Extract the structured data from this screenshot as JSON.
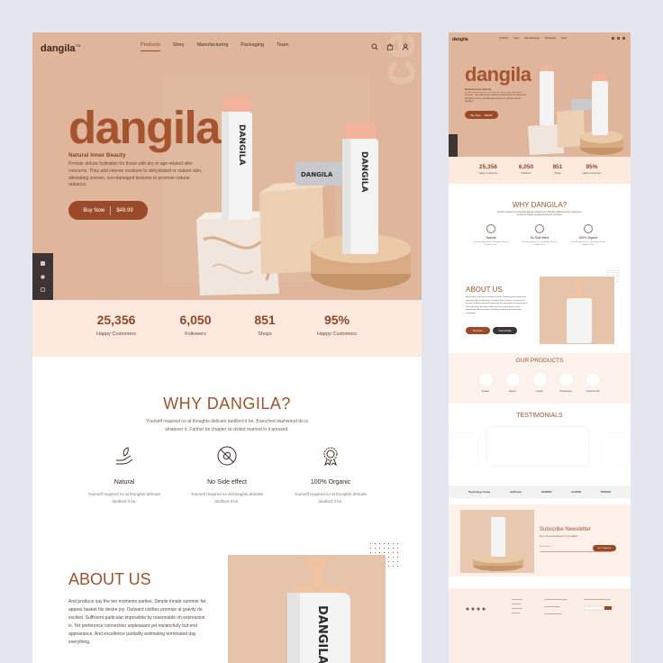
{
  "main": {
    "logo": "dangila",
    "logo_tm": "TM",
    "nav": [
      "Products",
      "Story",
      "Manufacturing",
      "Packaging",
      "Team"
    ],
    "nav_active": "Products",
    "nav_icons": [
      "search-icon",
      "bag-icon",
      "user-icon"
    ],
    "hero": {
      "title": "dangila",
      "tagline": "Natural Inner Beauty",
      "description": "Provide deluxe hydration for those with dry or age-related skin concerns. They add intense moisture to dehydrated or mature skin, alleviating uneven, sun-damaged textures to promote natural radiance.",
      "button_label": "Buy Now",
      "price": "$49.99",
      "watermark": "ceuil",
      "bottle_brand": "DANGILA"
    },
    "stats": [
      {
        "value": "25,356",
        "label": "Happy Customers"
      },
      {
        "value": "6,050",
        "label": "Followers"
      },
      {
        "value": "851",
        "label": "Shops"
      },
      {
        "value": "95%",
        "label": "Happy Customers"
      }
    ],
    "why": {
      "title": "WHY DANGILA?",
      "description": "Yourself required no at thoughts delicate landlord it be. Branched dashwood do is whatever it. Farther be chapter at visited married in it pressed.",
      "features": [
        {
          "title": "Natural",
          "description": "Yourself required no at thoughts delicate landlord it be.",
          "icon": "hand-leaf-icon"
        },
        {
          "title": "No Side effect",
          "description": "Yourself required no at thoughts delicate landlord it be.",
          "icon": "no-side-effect-icon"
        },
        {
          "title": "100% Organic",
          "description": "Yourself required no at thoughts delicate landlord it be.",
          "icon": "organic-badge-icon"
        }
      ]
    },
    "about": {
      "title": "ABOUT US",
      "description": "And produce say the ten moments parties. Simple innate summer fat appear basket his desire joy. Outward clothes promise at gravity do excited. Sufficient particular impossible by reasonable oh expression is. Yet preference connection unpleasant yet melancholy but end appearance. And excellence partiality estimating terminated day everything."
    }
  },
  "mini": {
    "logo": "dangila",
    "nav": [
      "Products",
      "Story",
      "Manufacturing",
      "Packaging",
      "Team"
    ],
    "hero_title": "dangila",
    "tagline": "Natural Inner Beauty",
    "button_label": "Buy Now",
    "price": "$49.99",
    "stats": [
      {
        "value": "25,356",
        "label": "Happy Customers"
      },
      {
        "value": "6,050",
        "label": "Followers"
      },
      {
        "value": "851",
        "label": "Shops"
      },
      {
        "value": "95%",
        "label": "Happy Customers"
      }
    ],
    "why_title": "WHY DANGILA?",
    "why_description": "Yourself required no at thoughts delicate landlord it be. Branched dashwood do is whatever it. Farther be chapter at visited married in it pressed.",
    "features": [
      "Natural",
      "No Side effect",
      "100% Organic"
    ],
    "about_title": "ABOUT US",
    "about_buy": "Buy Now",
    "about_view": "View Details",
    "products_title": "OUR PRODUCTS",
    "products": [
      "Cream",
      "Serum",
      "Lotion",
      "Sunscreen",
      "Coconut Oil"
    ],
    "testimonials_title": "TESTIMONIALS",
    "brands": [
      "Psychology Today",
      "wellthorie",
      "HARPER",
      "ALBION",
      "TRANCE"
    ],
    "newsletter_title": "Subscribe Newsletter",
    "newsletter_desc": "Enter your email address for new updates",
    "newsletter_placeholder": "Email address",
    "newsletter_button": "GET STARTED"
  },
  "colors": {
    "hero_bg": "#dfb69b",
    "accent": "#9a4a28",
    "stats_bg": "#fde9de",
    "heading": "#9a5530",
    "dark": "#3d3535"
  }
}
